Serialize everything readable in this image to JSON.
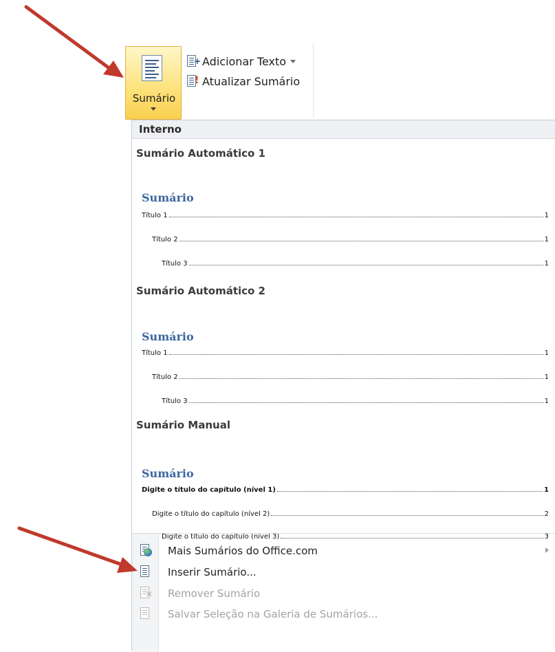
{
  "ribbon": {
    "toc_button_label": "Sumário",
    "add_text_label": "Adicionar Texto",
    "update_toc_label": "Atualizar Sumário"
  },
  "gallery": {
    "section_header": "Interno",
    "entries": [
      {
        "name": "Sumário Automático 1",
        "preview_title": "Sumário",
        "lines": [
          {
            "text": "Título 1",
            "page": "1"
          },
          {
            "text": "Título 2",
            "page": "1"
          },
          {
            "text": "Título 3",
            "page": "1"
          }
        ]
      },
      {
        "name": "Sumário Automático 2",
        "preview_title": "Sumário",
        "lines": [
          {
            "text": "Título 1",
            "page": "1"
          },
          {
            "text": "Título 2",
            "page": "1"
          },
          {
            "text": "Título 3",
            "page": "1"
          }
        ]
      },
      {
        "name": "Sumário Manual",
        "preview_title": "Sumário",
        "lines": [
          {
            "text": "Digite o título do capítulo (nível 1)",
            "page": "1"
          },
          {
            "text": "Digite o título do capítulo (nível 2)",
            "page": "2"
          },
          {
            "text": "Digite o título do capítulo (nível 3)",
            "page": "3"
          }
        ]
      }
    ]
  },
  "menu": [
    {
      "label": "Mais Sumários do Office.com",
      "icon": "office-globe-icon",
      "enabled": true,
      "submenu": true
    },
    {
      "label": "Inserir Sumário...",
      "icon": "document-icon",
      "enabled": true,
      "submenu": false
    },
    {
      "label": "Remover Sumário",
      "icon": "remove-document-icon",
      "enabled": false,
      "submenu": false
    },
    {
      "label": "Salvar Seleção na Galeria de Sumários...",
      "icon": "save-gallery-icon",
      "enabled": false,
      "submenu": false
    }
  ],
  "colors": {
    "accent_button": "#fde27a",
    "preview_title": "#3d67a0",
    "annotation_arrow": "#c0392b"
  }
}
